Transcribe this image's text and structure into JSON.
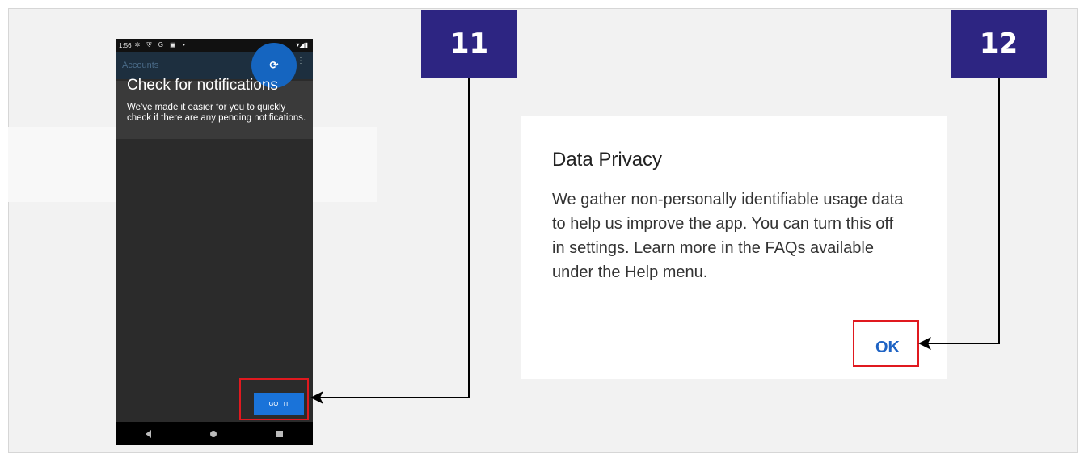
{
  "steps": {
    "step_11": "11",
    "step_12": "12"
  },
  "phone": {
    "status_time": "1:56",
    "status_icons": "✲ ⛨ G ▣ •",
    "status_right": "▾◢▮",
    "appbar_title": "Accounts",
    "coach_title": "Check for notifications",
    "coach_body": "We've made it easier for you to quickly check if there are any pending notifications.",
    "got_it_label": "GOT IT",
    "refresh_icon": "refresh-icon"
  },
  "dialog": {
    "title": "Data Privacy",
    "body": "We gather non-personally identifiable usage data to help us improve the app. You can turn this off in settings. Learn more in the FAQs available under the Help menu.",
    "ok_label": "OK"
  },
  "colors": {
    "badge": "#2d2582",
    "highlight": "#e0191f",
    "primary_button": "#1a73d9",
    "ok_text": "#1e63c4"
  }
}
